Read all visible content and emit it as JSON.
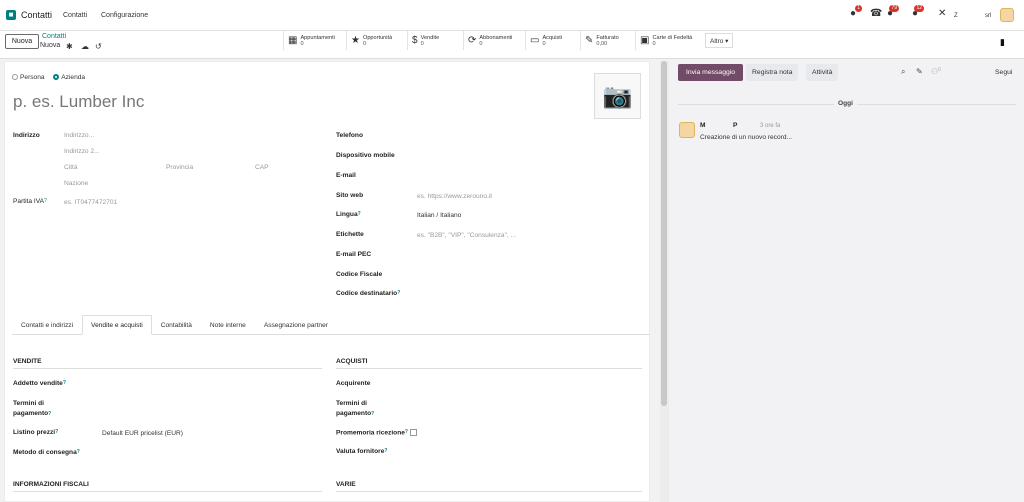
{
  "app": {
    "name": "Contatti"
  },
  "menu": [
    "Contatti",
    "Configurazione"
  ],
  "systray": {
    "badges": [
      "1",
      "79",
      "12"
    ],
    "user_initial": "Z",
    "company": "srl"
  },
  "breadcrumb": {
    "parent": "Contatti",
    "current": "Nuova"
  },
  "new_button": "Nuova",
  "stats": [
    {
      "icon": "calendar-icon",
      "label": "Appuntamenti",
      "value": "0"
    },
    {
      "icon": "star-icon",
      "label": "Opportunità",
      "value": "0"
    },
    {
      "icon": "dollar-icon",
      "label": "Vendite",
      "value": "0"
    },
    {
      "icon": "refresh-icon",
      "label": "Abbonamenti",
      "value": "0"
    },
    {
      "icon": "credit-card-icon",
      "label": "Acquisti",
      "value": "0"
    },
    {
      "icon": "invoice-icon",
      "label": "Fatturato",
      "value": "0,00"
    },
    {
      "icon": "loyalty-card-icon",
      "label": "Carte di Fedeltà",
      "value": "0"
    }
  ],
  "more_button": "Altro ▾",
  "form": {
    "type_persona": "Persona",
    "type_azienda": "Azienda",
    "name_placeholder": "p. es. Lumber Inc",
    "address_label": "Indirizzo",
    "address1_ph": "Indirizzo...",
    "address2_ph": "Indirizzo 2...",
    "city_ph": "Città",
    "province_ph": "Provincia",
    "zip_ph": "CAP",
    "country_ph": "Nazione",
    "vat_label": "Partita IVA",
    "vat_ph": "es. IT0477472701",
    "phone_label": "Telefono",
    "mobile_label": "Dispositivo mobile",
    "email_label": "E-mail",
    "website_label": "Sito web",
    "website_ph": "es. https://www.zerouno.it",
    "lang_label": "Lingua",
    "lang_value": "Italian / Italiano",
    "tags_label": "Etichette",
    "tags_ph": "es. \"B2B\", \"VIP\", \"Consulenza\", ...",
    "pec_label": "E-mail PEC",
    "fiscal_label": "Codice Fiscale",
    "dest_label": "Codice destinatario",
    "help": "?"
  },
  "tabs": [
    "Contatti e indirizzi",
    "Vendite e acquisti",
    "Contabilità",
    "Note interne",
    "Assegnazione partner"
  ],
  "sales": {
    "title": "VENDITE",
    "salesperson": "Addetto vendite",
    "payment_terms_1": "Termini di",
    "payment_terms_2": "pagamento",
    "pricelist": "Listino prezzi",
    "pricelist_value": "Default EUR pricelist (EUR)",
    "delivery": "Metodo di consegna",
    "fiscal_info": "INFORMAZIONI FISCALI"
  },
  "purchase": {
    "title": "ACQUISTI",
    "buyer": "Acquirente",
    "payment_terms_1": "Termini di",
    "payment_terms_2": "pagamento",
    "reminder": "Promemoria ricezione",
    "currency": "Valuta fornitore",
    "misc": "VARIE"
  },
  "chatter": {
    "send_message": "Invia messaggio",
    "log_note": "Registra nota",
    "activities": "Attività",
    "followers_count": "0",
    "follow": "Segui",
    "today": "Oggi",
    "author": "M               P",
    "time": "3 ore fa",
    "message": "Creazione di un nuovo record..."
  }
}
